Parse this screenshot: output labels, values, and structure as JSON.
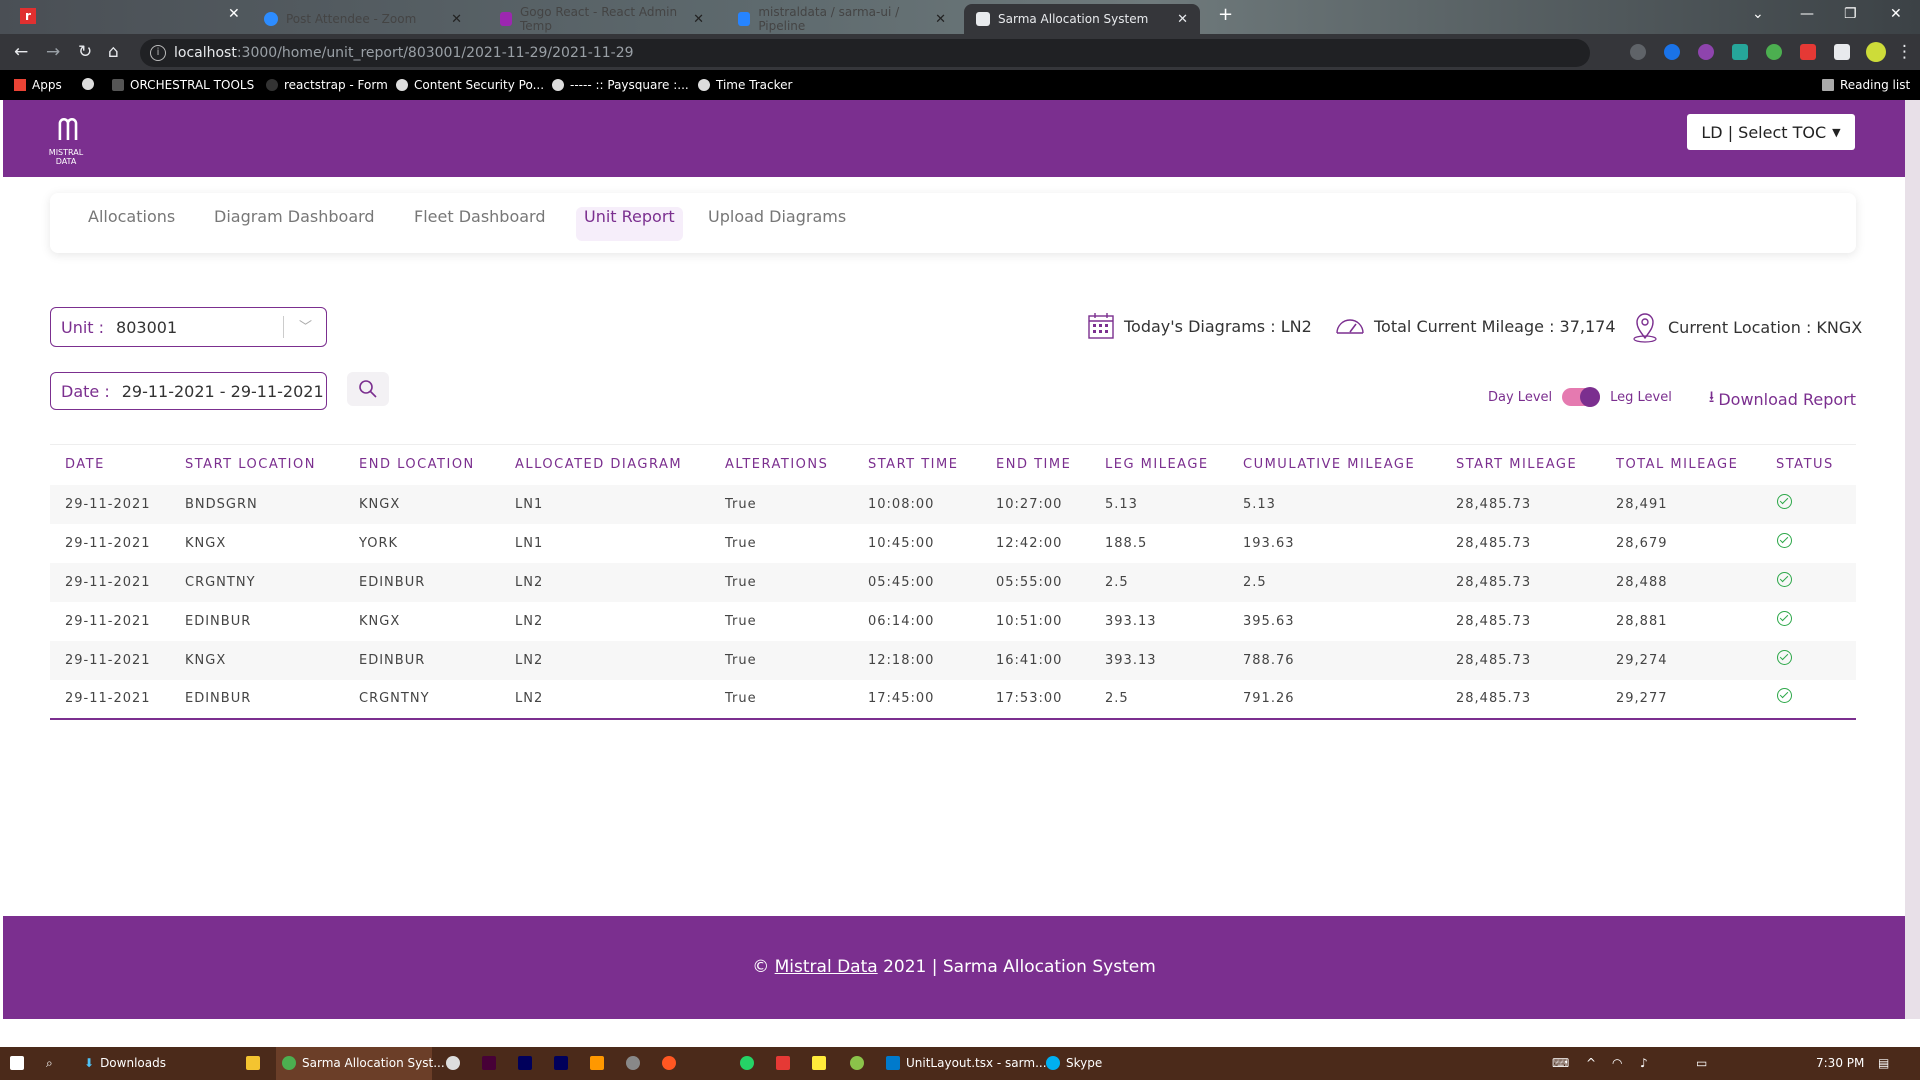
{
  "browser": {
    "tabs": [
      {
        "label": "Post Attendee - Zoom",
        "color": "#2d8cff"
      },
      {
        "label": "Gogo React - React Admin Temp",
        "color": "#9c27b0"
      },
      {
        "label": "mistraldata / sarma-ui / Pipeline",
        "color": "#2684ff"
      },
      {
        "label": "Sarma Allocation System",
        "color": "#ffffff"
      }
    ],
    "address": {
      "host": "localhost",
      "path": ":3000/home/unit_report/803001/2021-11-29/2021-11-29"
    },
    "bookmarks": [
      "Apps",
      "ORCHESTRAL TOOLS",
      "reactstrap - Form",
      "Content Security Po...",
      "----- :: Paysquare :...",
      "Time Tracker"
    ],
    "reading_list": "Reading list"
  },
  "header": {
    "logo_line1": "MISTRAL",
    "logo_line2": "DATA",
    "toc_label": "LD  | Select TOC"
  },
  "nav": {
    "items": [
      "Allocations",
      "Diagram Dashboard",
      "Fleet Dashboard",
      "Unit Report",
      "Upload Diagrams"
    ],
    "active": "Unit Report"
  },
  "filters": {
    "unit_label": "Unit :",
    "unit_value": "803001",
    "date_label": "Date :",
    "date_value": "29-11-2021 - 29-11-2021"
  },
  "stats": {
    "diagrams": "Today's Diagrams : LN2",
    "mileage": "Total Current Mileage : 37,174",
    "location": "Current Location : KNGX"
  },
  "toggle": {
    "left": "Day Level",
    "right": "Leg Level",
    "state": "on"
  },
  "download_label": "Download Report",
  "table": {
    "headers": [
      "DATE",
      "START LOCATION",
      "END LOCATION",
      "ALLOCATED DIAGRAM",
      "ALTERATIONS",
      "START TIME",
      "END TIME",
      "LEG MILEAGE",
      "CUMULATIVE MILEAGE",
      "START MILEAGE",
      "TOTAL MILEAGE",
      "STATUS"
    ],
    "rows": [
      [
        "29-11-2021",
        "BNDSGRN",
        "KNGX",
        "LN1",
        "True",
        "10:08:00",
        "10:27:00",
        "5.13",
        "5.13",
        "28,485.73",
        "28,491"
      ],
      [
        "29-11-2021",
        "KNGX",
        "YORK",
        "LN1",
        "True",
        "10:45:00",
        "12:42:00",
        "188.5",
        "193.63",
        "28,485.73",
        "28,679"
      ],
      [
        "29-11-2021",
        "CRGNTNY",
        "EDINBUR",
        "LN2",
        "True",
        "05:45:00",
        "05:55:00",
        "2.5",
        "2.5",
        "28,485.73",
        "28,488"
      ],
      [
        "29-11-2021",
        "EDINBUR",
        "KNGX",
        "LN2",
        "True",
        "06:14:00",
        "10:51:00",
        "393.13",
        "395.63",
        "28,485.73",
        "28,881"
      ],
      [
        "29-11-2021",
        "KNGX",
        "EDINBUR",
        "LN2",
        "True",
        "12:18:00",
        "16:41:00",
        "393.13",
        "788.76",
        "28,485.73",
        "29,274"
      ],
      [
        "29-11-2021",
        "EDINBUR",
        "CRGNTNY",
        "LN2",
        "True",
        "17:45:00",
        "17:53:00",
        "2.5",
        "791.26",
        "28,485.73",
        "29,277"
      ]
    ],
    "status_icon": "check-circle-icon"
  },
  "footer": {
    "copy": "©",
    "brand": "Mistral Data",
    "rest": " 2021 | Sarma Allocation System"
  },
  "taskbar": {
    "items": [
      "Downloads",
      "Sarma Allocation Syst...",
      "UnitLayout.tsx - sarm...",
      "Skype"
    ],
    "time": "7:30 PM"
  },
  "colors": {
    "brand": "#7b2f8f",
    "status_ok": "#2ea84a"
  }
}
